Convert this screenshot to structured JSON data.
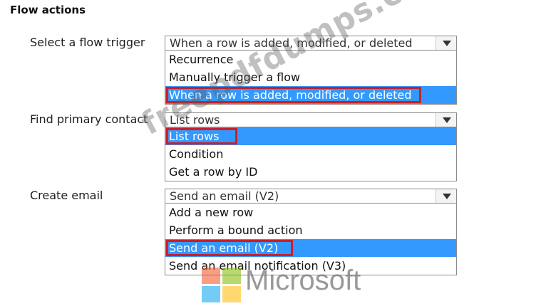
{
  "header": {
    "title": "Flow actions"
  },
  "rows": [
    {
      "label": "Select a flow trigger",
      "selected_value": "When a row is added, modified, or deleted",
      "options": [
        "Recurrence",
        "Manually trigger a flow",
        "When a row is added, modified, or deleted"
      ],
      "highlighted_index": 2
    },
    {
      "label": "Find primary contact",
      "selected_value": "List rows",
      "options": [
        "List rows",
        "Condition",
        "Get a row by ID"
      ],
      "highlighted_index": 0
    },
    {
      "label": "Create email",
      "selected_value": "Send an email (V2)",
      "options": [
        "Add a new row",
        "Perform a bound action",
        "Send an email (V2)",
        "Send an email notification (V3)"
      ],
      "highlighted_index": 2
    }
  ],
  "watermark": {
    "text": "freepdfdumps.com"
  },
  "brand": {
    "name": "Microsoft",
    "colors": [
      "#f25022",
      "#7fba00",
      "#00a4ef",
      "#ffb900"
    ]
  },
  "colors": {
    "selection": "#3399ff",
    "highlight_border": "#c8202c"
  }
}
